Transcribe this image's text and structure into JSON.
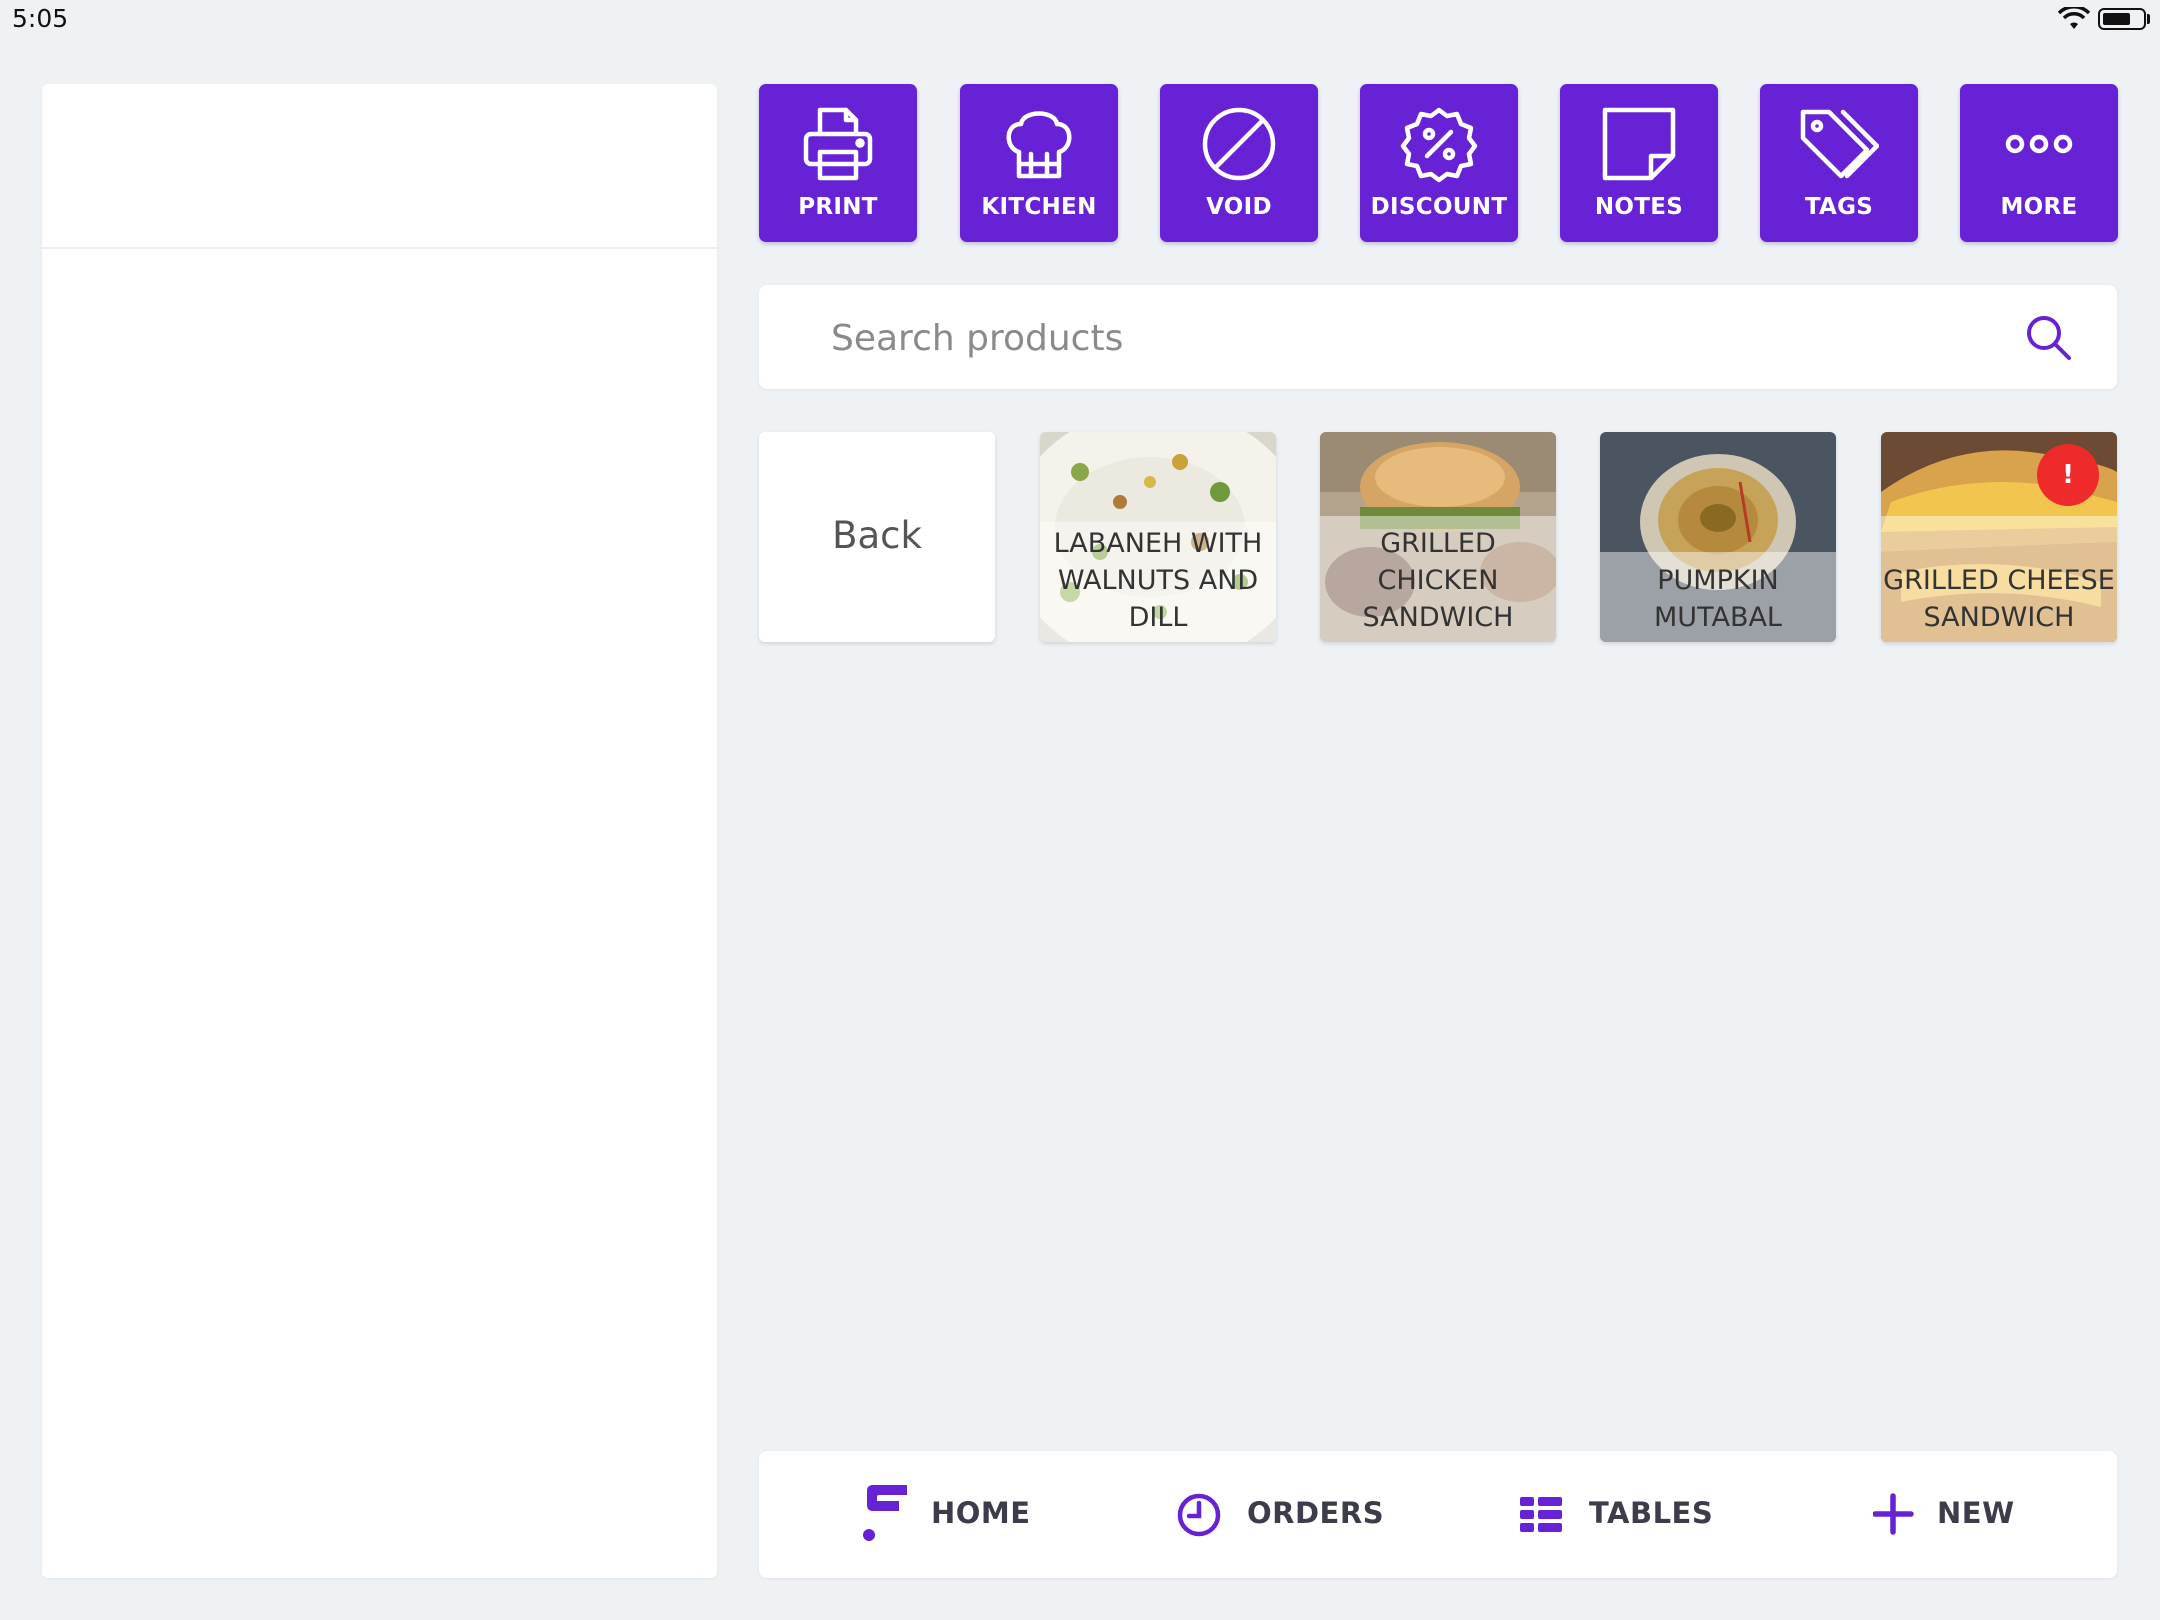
{
  "status_bar": {
    "time": "5:05",
    "battery_level": 0.7
  },
  "colors": {
    "accent": "#6622d4",
    "background": "#eff2f5",
    "alert": "#ee2a2a"
  },
  "toolbar": {
    "buttons": [
      {
        "label": "PRINT",
        "icon": "printer-icon"
      },
      {
        "label": "KITCHEN",
        "icon": "chef-hat-icon"
      },
      {
        "label": "VOID",
        "icon": "void-icon"
      },
      {
        "label": "DISCOUNT",
        "icon": "discount-icon"
      },
      {
        "label": "NOTES",
        "icon": "note-icon"
      },
      {
        "label": "TAGS",
        "icon": "tags-icon"
      },
      {
        "label": "MORE",
        "icon": "more-icon"
      }
    ]
  },
  "search": {
    "placeholder": "Search products"
  },
  "products": {
    "back_label": "Back",
    "items": [
      {
        "name": "LABANEH WITH WALNUTS AND DILL",
        "alert": false
      },
      {
        "name": "GRILLED CHICKEN SANDWICH",
        "alert": false
      },
      {
        "name": "PUMPKIN MUTABAL",
        "alert": false
      },
      {
        "name": "GRILLED CHEESE SANDWICH",
        "alert": true,
        "alert_text": "!"
      }
    ]
  },
  "bottom_nav": {
    "items": [
      {
        "label": "HOME",
        "icon": "home-logo-icon"
      },
      {
        "label": "ORDERS",
        "icon": "clock-icon"
      },
      {
        "label": "TABLES",
        "icon": "tables-icon"
      },
      {
        "label": "NEW",
        "icon": "plus-icon"
      }
    ]
  }
}
